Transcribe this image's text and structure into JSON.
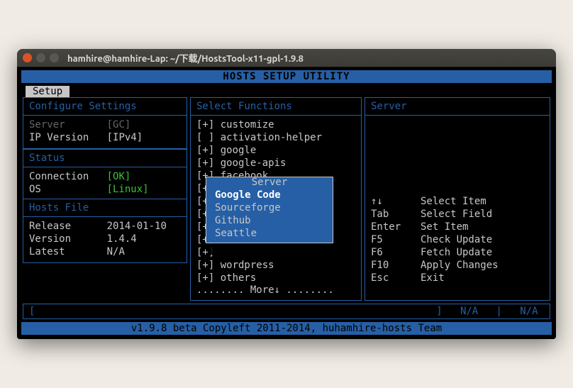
{
  "window": {
    "title": "hamhire@hamhire-Lap: ~/下载/HostsTool-x11-gpl-1.9.8"
  },
  "header": {
    "title": "HOSTS SETUP UTILITY"
  },
  "tab": {
    "label": "Setup"
  },
  "config": {
    "title": "Configure Settings",
    "server_label": "Server",
    "server_value": "[GC]",
    "ipver_label": "IP Version",
    "ipver_value": "[IPv4]"
  },
  "status": {
    "title": "Status",
    "conn_label": "Connection",
    "conn_value": "[OK]",
    "os_label": "OS",
    "os_value": "[Linux]"
  },
  "hostsfile": {
    "title": "Hosts File",
    "release_label": "Release",
    "release_value": "2014-01-10",
    "version_label": "Version",
    "version_value": "1.4.4",
    "latest_label": "Latest",
    "latest_value": "N/A"
  },
  "functions": {
    "title": "Select Functions",
    "items": [
      {
        "mark": "[+]",
        "label": "customize"
      },
      {
        "mark": "[ ]",
        "label": "activation-helper"
      },
      {
        "mark": "[+]",
        "label": "google"
      },
      {
        "mark": "[+]",
        "label": "google-apis"
      },
      {
        "mark": "[+]",
        "label": "facebook"
      },
      {
        "mark": "[+]",
        "label": ""
      },
      {
        "mark": "[+]",
        "label": ""
      },
      {
        "mark": "[+]",
        "label": ""
      },
      {
        "mark": "[+]",
        "label": ""
      },
      {
        "mark": "[+]",
        "label": ""
      },
      {
        "mark": "[+]",
        "label": ""
      },
      {
        "mark": "[+]",
        "label": "wordpress"
      },
      {
        "mark": "[+]",
        "label": "others"
      }
    ],
    "more": "........ More↓ ........"
  },
  "server_panel": {
    "title": "Server"
  },
  "help": {
    "rows": [
      {
        "key": "↑↓",
        "label": "Select Item"
      },
      {
        "key": "Tab",
        "label": "Select Field"
      },
      {
        "key": "Enter",
        "label": "Set Item"
      },
      {
        "key": "F5",
        "label": "Check Update"
      },
      {
        "key": "F6",
        "label": "Fetch Update"
      },
      {
        "key": "F10",
        "label": "Apply Changes"
      },
      {
        "key": "Esc",
        "label": "Exit"
      }
    ]
  },
  "popup": {
    "title": "Server",
    "items": [
      "Google Code",
      "Sourceforge",
      "Github",
      "Seattle"
    ],
    "selected": 0
  },
  "bottom": {
    "left": "[",
    "right_a": "]",
    "na1": "N/A",
    "sep": "|",
    "na2": "N/A"
  },
  "footer": {
    "text": "v1.9.8 beta Copyleft 2011-2014, huhamhire-hosts Team"
  }
}
